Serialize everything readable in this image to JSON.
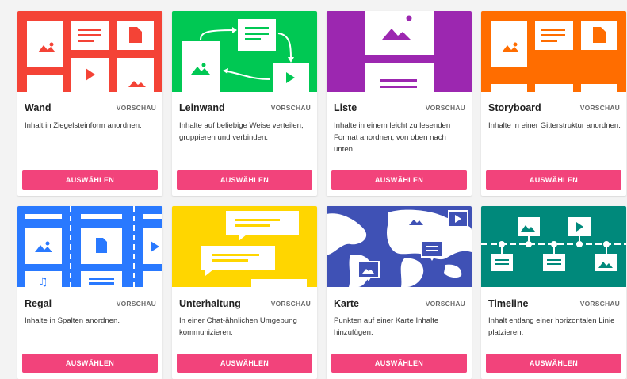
{
  "preview_label": "VORSCHAU",
  "select_label": "AUSWÄHLEN",
  "colors": {
    "wand": "#f44336",
    "leinwand": "#00c853",
    "liste": "#9c27b0",
    "storyboard": "#ff6d00",
    "regal": "#2979ff",
    "unterhaltung": "#ffd600",
    "karte": "#3f51b5",
    "timeline": "#00897b",
    "button": "#f2437b"
  },
  "cards": [
    {
      "title": "Wand",
      "desc": "Inhalt in Ziegelsteinform anordnen."
    },
    {
      "title": "Leinwand",
      "desc": "Inhalte auf beliebige Weise verteilen, gruppieren und verbinden."
    },
    {
      "title": "Liste",
      "desc": "Inhalte in einem leicht zu lesenden Format anordnen, von oben nach unten."
    },
    {
      "title": "Storyboard",
      "desc": "Inhalte in einer Gitterstruktur anordnen."
    },
    {
      "title": "Regal",
      "desc": "Inhalte in Spalten anordnen."
    },
    {
      "title": "Unterhaltung",
      "desc": "In einer Chat-ähnlichen Umgebung kommunizieren."
    },
    {
      "title": "Karte",
      "desc": "Punkten auf einer Karte Inhalte hinzufügen."
    },
    {
      "title": "Timeline",
      "desc": "Inhalt entlang einer horizontalen Linie platzieren."
    }
  ]
}
